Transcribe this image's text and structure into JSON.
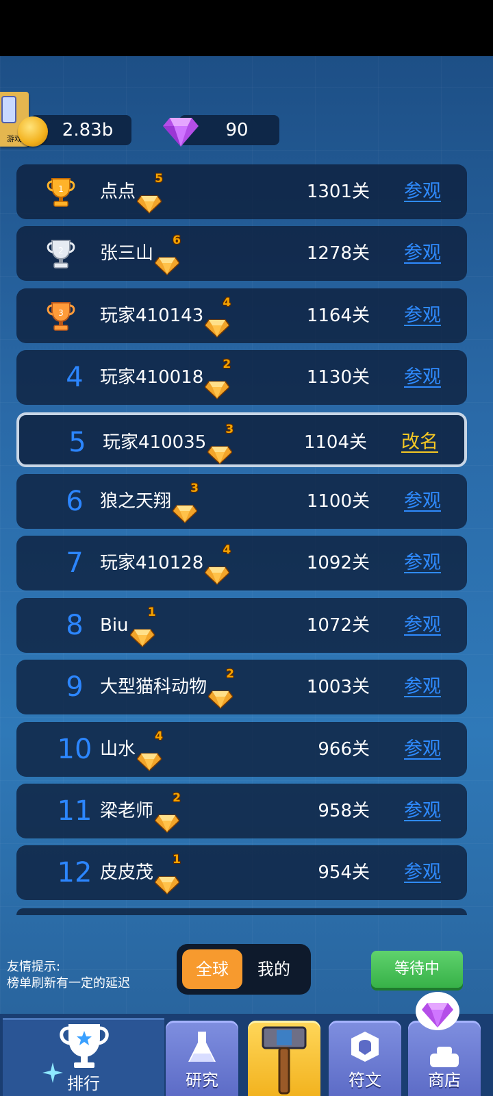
{
  "resources": {
    "coins": "2.83b",
    "gems": "90",
    "app_badge": "游戏"
  },
  "leaderboard": [
    {
      "rank": "1",
      "name": "点点",
      "vip": "5",
      "level": "1301关",
      "action": "参观"
    },
    {
      "rank": "2",
      "name": "张三山",
      "vip": "6",
      "level": "1278关",
      "action": "参观"
    },
    {
      "rank": "3",
      "name": "玩家410143",
      "vip": "4",
      "level": "1164关",
      "action": "参观"
    },
    {
      "rank": "4",
      "name": "玩家410018",
      "vip": "2",
      "level": "1130关",
      "action": "参观"
    },
    {
      "rank": "5",
      "name": "玩家410035",
      "vip": "3",
      "level": "1104关",
      "action": "改名"
    },
    {
      "rank": "6",
      "name": "狼之天翔",
      "vip": "3",
      "level": "1100关",
      "action": "参观"
    },
    {
      "rank": "7",
      "name": "玩家410128",
      "vip": "4",
      "level": "1092关",
      "action": "参观"
    },
    {
      "rank": "8",
      "name": "Biu",
      "vip": "1",
      "level": "1072关",
      "action": "参观"
    },
    {
      "rank": "9",
      "name": "大型猫科动物",
      "vip": "2",
      "level": "1003关",
      "action": "参观"
    },
    {
      "rank": "10",
      "name": "山水",
      "vip": "4",
      "level": "966关",
      "action": "参观"
    },
    {
      "rank": "11",
      "name": "梁老师",
      "vip": "2",
      "level": "958关",
      "action": "参观"
    },
    {
      "rank": "12",
      "name": "皮皮茂",
      "vip": "1",
      "level": "954关",
      "action": "参观"
    }
  ],
  "tip": {
    "line1": "友情提示:",
    "line2": "榜单刷新有一定的延迟"
  },
  "scope_toggle": {
    "global": "全球",
    "mine": "我的",
    "selected": "全球"
  },
  "waiting_button": "等待中",
  "nav": {
    "rank": "排行",
    "research": "研究",
    "runes": "符文",
    "shop": "商店"
  },
  "colors": {
    "rank_blue": "#2c86ff",
    "link_blue": "#2f8bff",
    "rename_yellow": "#f6c823",
    "toggle_orange": "#f79a2e",
    "button_green": "#37b148"
  }
}
